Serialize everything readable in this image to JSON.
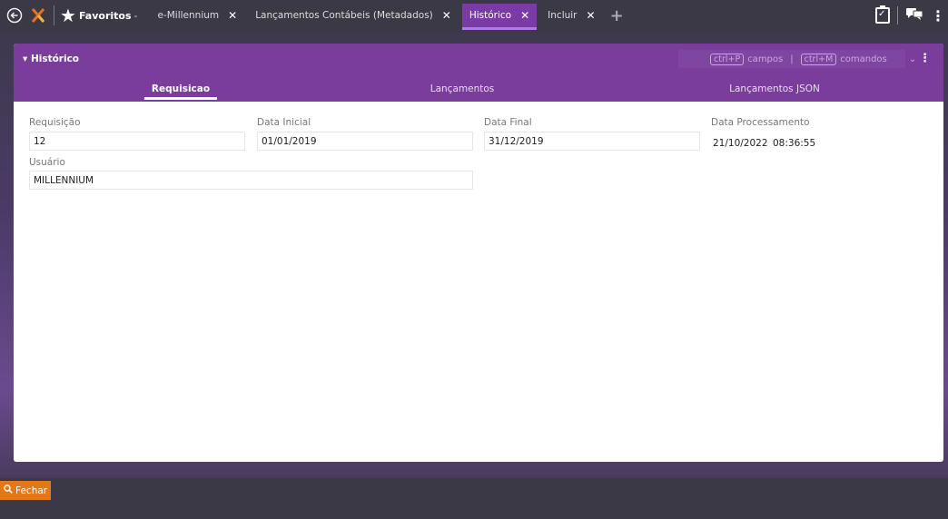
{
  "topbar": {
    "favorites_label": "Favoritos",
    "tabs": [
      {
        "label": "e-Millennium",
        "active": false
      },
      {
        "label": "Lançamentos Contábeis (Metadados)",
        "active": false
      },
      {
        "label": "Histórico",
        "active": true
      },
      {
        "label": "Incluir",
        "active": false
      }
    ],
    "icons": {
      "back": "back-arrow-icon",
      "logo": "millennium-logo-icon",
      "favorites": "star-icon",
      "add_tab": "plus-icon",
      "clipboard": "clipboard-check-icon",
      "chat": "chat-icon",
      "menu": "kebab-icon"
    }
  },
  "panel": {
    "title": "Histórico",
    "shortcut_fields_key": "ctrl+P",
    "shortcut_fields_label": "campos",
    "shortcut_commands_key": "ctrl+M",
    "shortcut_commands_label": "comandos",
    "subtabs": [
      {
        "label": "Requisicao",
        "active": true
      },
      {
        "label": "Lançamentos",
        "active": false
      },
      {
        "label": "Lançamentos JSON",
        "active": false
      }
    ]
  },
  "form": {
    "requisicao_label": "Requisição",
    "requisicao_value": "12",
    "data_inicial_label": "Data Inicial",
    "data_inicial_value": "01/01/2019",
    "data_final_label": "Data Final",
    "data_final_value": "31/12/2019",
    "data_processamento_label": "Data Processamento",
    "data_processamento_date": "21/10/2022",
    "data_processamento_time": "08:36:55",
    "usuario_label": "Usuário",
    "usuario_value": "MILLENNIUM"
  },
  "bottombar": {
    "fechar_label": "Fechar"
  },
  "colors": {
    "accent": "#7a3d9c",
    "close_button": "#e67716",
    "topbar": "#3a3945"
  }
}
